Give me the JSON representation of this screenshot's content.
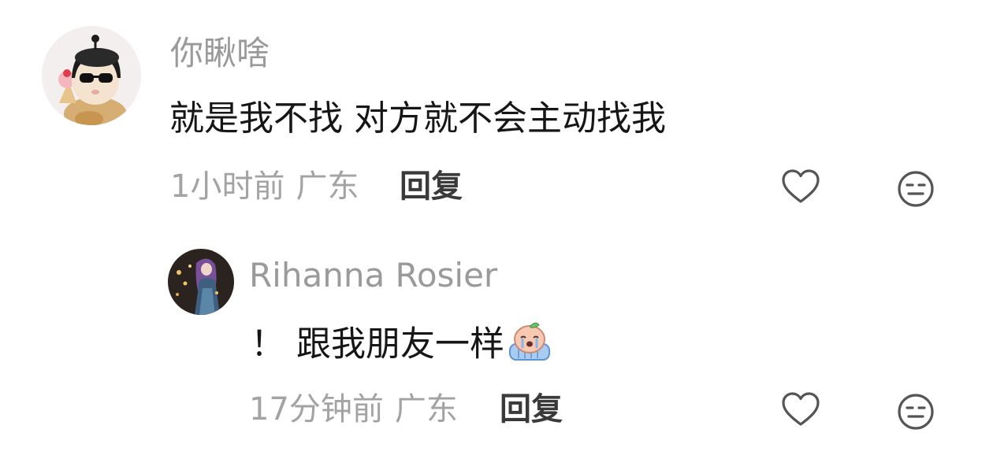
{
  "comments": [
    {
      "username": "你瞅啥",
      "content": "就是我不找 对方就不会主动找我",
      "time": "1小时前",
      "location": "广东",
      "reply_label": "回复"
    },
    {
      "username": "Rihanna Rosier",
      "content": "！ 跟我朋友一样",
      "time": "17分钟前",
      "location": "广东",
      "reply_label": "回复",
      "emoji": "crying-emoji"
    }
  ],
  "icons": {
    "like": "heart-outline-icon",
    "dislike": "neutral-face-icon"
  },
  "colors": {
    "username": "#9a9a9a",
    "content": "#161616",
    "meta": "#a3a3a3",
    "reply": "#3a3a3a",
    "icon": "#555555"
  }
}
